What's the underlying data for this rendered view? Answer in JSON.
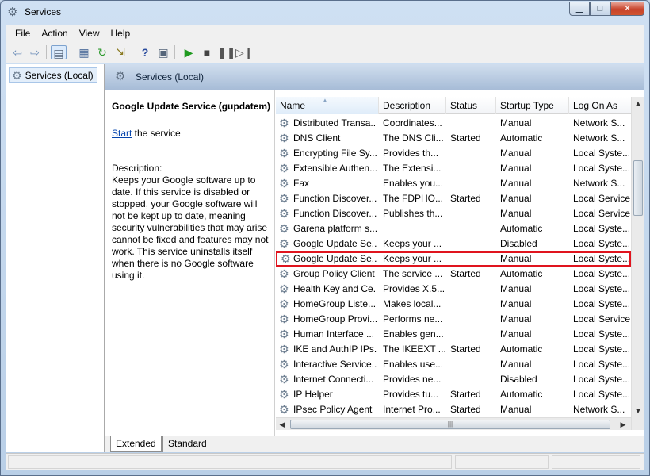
{
  "window": {
    "title": "Services"
  },
  "menu": [
    "File",
    "Action",
    "View",
    "Help"
  ],
  "tree": {
    "label": "Services (Local)"
  },
  "panel": {
    "title": "Services (Local)"
  },
  "description_pane": {
    "service_name": "Google Update Service (gupdatem)",
    "start_link": "Start",
    "start_suffix": " the service",
    "description_label": "Description:",
    "description_text": "Keeps your Google software up to date. If this service is disabled or stopped, your Google software will not be kept up to date, meaning security vulnerabilities that may arise cannot be fixed and features may not work. This service uninstalls itself when there is no Google software using it."
  },
  "columns": [
    "Name",
    "Description",
    "Status",
    "Startup Type",
    "Log On As"
  ],
  "rows": [
    {
      "name": "Distributed Transa...",
      "description": "Coordinates...",
      "status": "",
      "startup": "Manual",
      "logon": "Network S..."
    },
    {
      "name": "DNS Client",
      "description": "The DNS Cli...",
      "status": "Started",
      "startup": "Automatic",
      "logon": "Network S..."
    },
    {
      "name": "Encrypting File Sy...",
      "description": "Provides th...",
      "status": "",
      "startup": "Manual",
      "logon": "Local Syste..."
    },
    {
      "name": "Extensible Authen...",
      "description": "The Extensi...",
      "status": "",
      "startup": "Manual",
      "logon": "Local Syste..."
    },
    {
      "name": "Fax",
      "description": "Enables you...",
      "status": "",
      "startup": "Manual",
      "logon": "Network S..."
    },
    {
      "name": "Function Discover...",
      "description": "The FDPHO...",
      "status": "Started",
      "startup": "Manual",
      "logon": "Local Service"
    },
    {
      "name": "Function Discover...",
      "description": "Publishes th...",
      "status": "",
      "startup": "Manual",
      "logon": "Local Service"
    },
    {
      "name": "Garena platform s...",
      "description": "",
      "status": "",
      "startup": "Automatic",
      "logon": "Local Syste..."
    },
    {
      "name": "Google Update Se...",
      "description": "Keeps your ...",
      "status": "",
      "startup": "Disabled",
      "logon": "Local Syste..."
    },
    {
      "name": "Google Update Se...",
      "description": "Keeps your ...",
      "status": "",
      "startup": "Manual",
      "logon": "Local Syste...",
      "selected": true
    },
    {
      "name": "Group Policy Client",
      "description": "The service ...",
      "status": "Started",
      "startup": "Automatic",
      "logon": "Local Syste..."
    },
    {
      "name": "Health Key and Ce...",
      "description": "Provides X.5...",
      "status": "",
      "startup": "Manual",
      "logon": "Local Syste..."
    },
    {
      "name": "HomeGroup Liste...",
      "description": "Makes local...",
      "status": "",
      "startup": "Manual",
      "logon": "Local Syste..."
    },
    {
      "name": "HomeGroup Provi...",
      "description": "Performs ne...",
      "status": "",
      "startup": "Manual",
      "logon": "Local Service"
    },
    {
      "name": "Human Interface ...",
      "description": "Enables gen...",
      "status": "",
      "startup": "Manual",
      "logon": "Local Syste..."
    },
    {
      "name": "IKE and AuthIP IPs...",
      "description": "The IKEEXT ...",
      "status": "Started",
      "startup": "Automatic",
      "logon": "Local Syste..."
    },
    {
      "name": "Interactive Service...",
      "description": "Enables use...",
      "status": "",
      "startup": "Manual",
      "logon": "Local Syste..."
    },
    {
      "name": "Internet Connecti...",
      "description": "Provides ne...",
      "status": "",
      "startup": "Disabled",
      "logon": "Local Syste..."
    },
    {
      "name": "IP Helper",
      "description": "Provides tu...",
      "status": "Started",
      "startup": "Automatic",
      "logon": "Local Syste..."
    },
    {
      "name": "IPsec Policy Agent",
      "description": "Internet Pro...",
      "status": "Started",
      "startup": "Manual",
      "logon": "Network S..."
    }
  ],
  "tabs": [
    "Extended",
    "Standard"
  ],
  "colors": {
    "selection_border": "#e0141e",
    "link": "#0645ad",
    "header_gradient_top": "#d0deee"
  },
  "icons": {
    "service": "gear-icon",
    "back": "back-arrow-icon",
    "forward": "forward-arrow-icon"
  }
}
